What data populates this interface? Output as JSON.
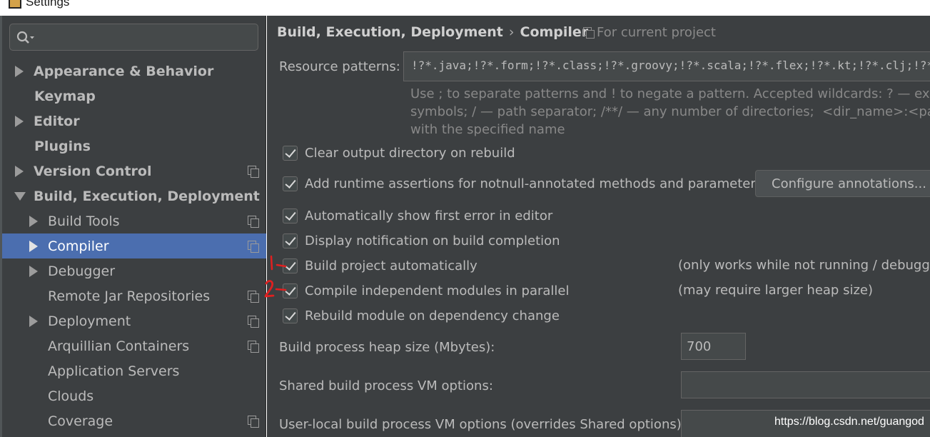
{
  "window": {
    "title": "Settings"
  },
  "sidebar": {
    "items": [
      {
        "label": "Appearance & Behavior",
        "bold": true,
        "arrow": true
      },
      {
        "label": "Keymap",
        "bold": true,
        "arrow": false
      },
      {
        "label": "Editor",
        "bold": true,
        "arrow": true
      },
      {
        "label": "Plugins",
        "bold": true,
        "arrow": false
      },
      {
        "label": "Version Control",
        "bold": true,
        "arrow": true,
        "project_icon": true
      },
      {
        "label": "Build, Execution, Deployment",
        "bold": true,
        "arrow": true,
        "expanded": true
      },
      {
        "label": "Build Tools",
        "arrow": true,
        "project_icon": true
      },
      {
        "label": "Compiler",
        "arrow": true,
        "project_icon": true,
        "selected": true
      },
      {
        "label": "Debugger",
        "arrow": true
      },
      {
        "label": "Remote Jar Repositories",
        "arrow": false,
        "project_icon": true
      },
      {
        "label": "Deployment",
        "arrow": true,
        "project_icon": true
      },
      {
        "label": "Arquillian Containers",
        "arrow": false,
        "project_icon": true
      },
      {
        "label": "Application Servers",
        "arrow": false
      },
      {
        "label": "Clouds",
        "arrow": false
      },
      {
        "label": "Coverage",
        "arrow": false,
        "project_icon": true
      }
    ]
  },
  "main": {
    "breadcrumb": {
      "parent": "Build, Execution, Deployment",
      "separator": "›",
      "current": "Compiler"
    },
    "for_project": "For current project",
    "resource_patterns": {
      "label": "Resource patterns:",
      "value": "!?*.java;!?*.form;!?*.class;!?*.groovy;!?*.scala;!?*.flex;!?*.kt;!?*.clj;!?*.aj"
    },
    "help": {
      "line1": "Use ; to separate patterns and ! to negate a pattern. Accepted wildcards: ? — exactly one symbol; * — zero or more",
      "line2": "symbols; / — path separator; /**/ — any number of directories;  <dir_name>:<pattern> — restrict to source roots",
      "line3": "with the specified name"
    },
    "checkboxes": [
      {
        "label": "Clear output directory on rebuild",
        "checked": true
      },
      {
        "label": "Add runtime assertions for notnull-annotated methods and parameters",
        "checked": true
      },
      {
        "label": "Automatically show first error in editor",
        "checked": true
      },
      {
        "label": "Display notification on build completion",
        "checked": true
      },
      {
        "label": "Build project automatically",
        "checked": true,
        "note": "(only works while not running / debugging)"
      },
      {
        "label": "Compile independent modules in parallel",
        "checked": true,
        "note": "(may require larger heap size)"
      },
      {
        "label": "Rebuild module on dependency change",
        "checked": true
      }
    ],
    "configure_button": "Configure annotations...",
    "heap": {
      "label": "Build process heap size (Mbytes):",
      "value": "700"
    },
    "shared_vm": {
      "label": "Shared build process VM options:",
      "value": ""
    },
    "user_vm": {
      "label": "User-local build process VM options (overrides Shared options):",
      "value": ""
    }
  },
  "annotations": {
    "mark1": "1",
    "mark2": "2",
    "color": "#e02020"
  },
  "watermark": "https://blog.csdn.net/guangod",
  "colors": {
    "panel": "#3c3f41",
    "selection": "#4b6eaf",
    "text": "#bbbbbb"
  }
}
